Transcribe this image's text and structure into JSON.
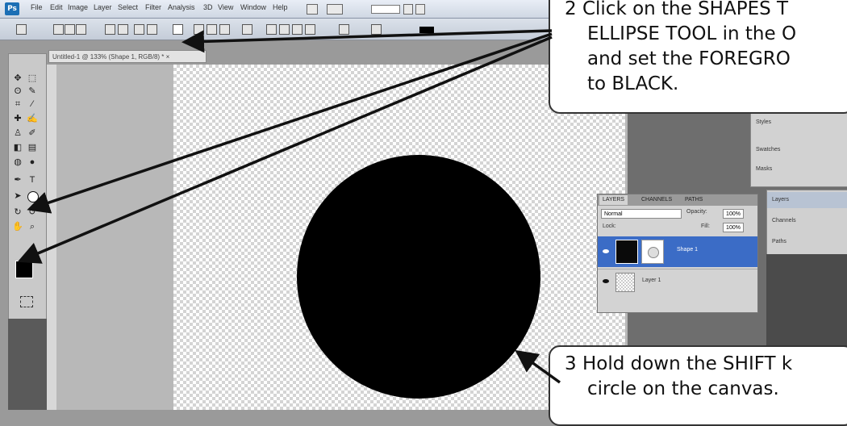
{
  "app": {
    "logo_text": "Ps",
    "menu_items": [
      "File",
      "Edit",
      "Image",
      "Layer",
      "Select",
      "Filter",
      "Analysis",
      "3D",
      "View",
      "Window",
      "Help"
    ]
  },
  "document": {
    "tab_title": "Untitled-1 @ 133% (Shape 1, RGB/8) *  ×"
  },
  "right_panel": {
    "items": [
      "Styles",
      "Swatches",
      "Masks"
    ],
    "panel_b_items": [
      "Layers",
      "Channels",
      "Paths"
    ]
  },
  "layers_panel": {
    "tabs": [
      "LAYERS",
      "CHANNELS",
      "PATHS"
    ],
    "blend_mode": "Normal",
    "opacity_label": "Opacity:",
    "opacity_value": "100%",
    "lock_label": "Lock:",
    "fill_label": "Fill:",
    "fill_value": "100%",
    "layers": [
      {
        "name": "Shape 1"
      },
      {
        "name": "Layer 1"
      }
    ]
  },
  "callouts": {
    "step2": {
      "number": "2",
      "line1": "Click on the SHAPES T",
      "line2": "ELLIPSE TOOL in the O",
      "line3": "and set the FOREGRO",
      "line4": "to BLACK."
    },
    "step3": {
      "number": "3",
      "line1": "Hold down the SHIFT k",
      "line2": "circle on the canvas."
    }
  },
  "colors": {
    "foreground": "#000000",
    "circle_fill": "#000000",
    "selected_layer": "#3b6cc6"
  }
}
